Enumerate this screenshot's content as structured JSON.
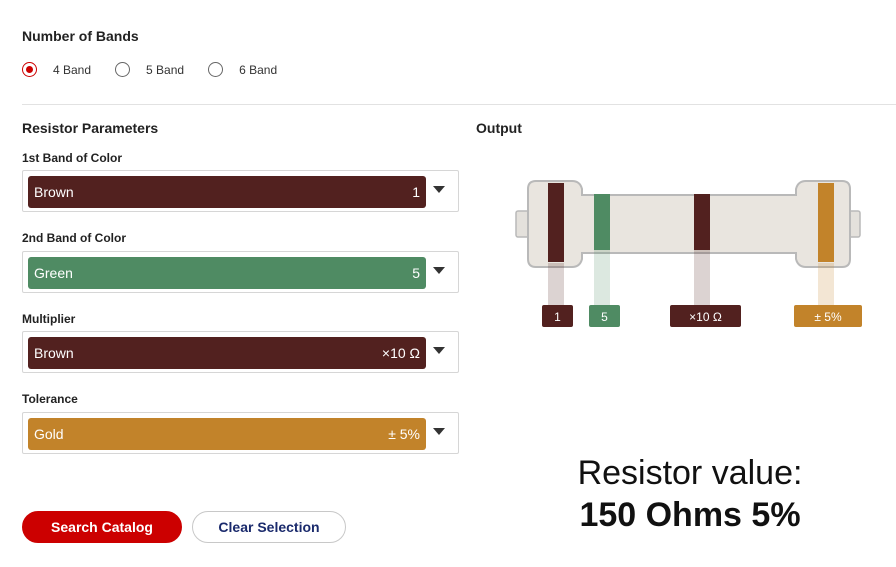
{
  "bands_section": {
    "title": "Number of Bands",
    "options": [
      {
        "label": "4 Band",
        "selected": true
      },
      {
        "label": "5 Band",
        "selected": false
      },
      {
        "label": "6 Band",
        "selected": false
      }
    ]
  },
  "params": {
    "title": "Resistor Parameters",
    "fields": [
      {
        "label": "1st Band of Color",
        "color_name": "Brown",
        "value": "1",
        "color": "#52211f"
      },
      {
        "label": "2nd Band of Color",
        "color_name": "Green",
        "value": "5",
        "color": "#4f8b63"
      },
      {
        "label": "Multiplier",
        "color_name": "Brown",
        "value": "×10 Ω",
        "color": "#52211f"
      },
      {
        "label": "Tolerance",
        "color_name": "Gold",
        "value": "± 5%",
        "color": "#c2832a"
      }
    ]
  },
  "output": {
    "title": "Output",
    "band_tags": [
      "1",
      "5",
      "×10 Ω",
      "± 5%"
    ],
    "result_label": "Resistor value:",
    "result_value": "150 Ohms 5%"
  },
  "buttons": {
    "search_label": "Search Catalog",
    "clear_label": "Clear Selection"
  },
  "colors": {
    "accent": "#cc0000",
    "resistor_body": "#e9e5df",
    "resistor_outline": "#b9b9b9"
  }
}
